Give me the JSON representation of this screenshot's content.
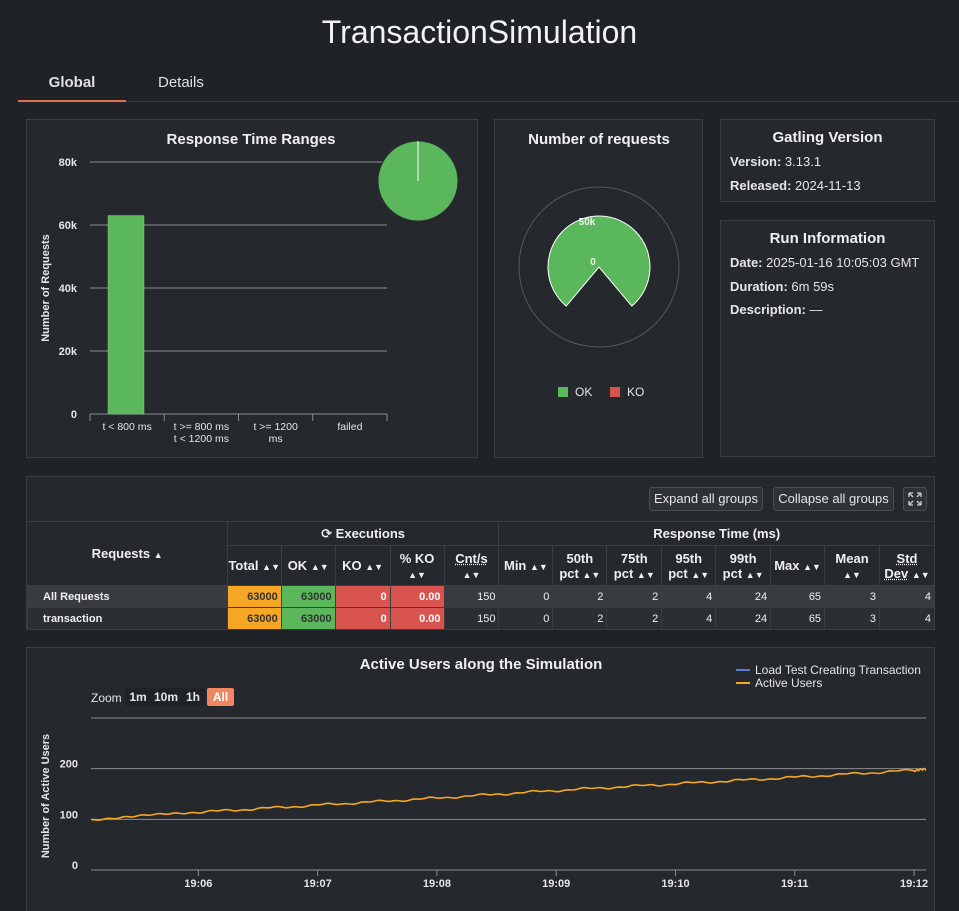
{
  "page": {
    "title": "TransactionSimulation"
  },
  "tabs": [
    {
      "label": "Global"
    },
    {
      "label": "Details"
    }
  ],
  "ranges": {
    "title": "Response Time Ranges",
    "ylabel": "Number of Requests",
    "yticks": [
      "0",
      "20k",
      "40k",
      "60k",
      "80k"
    ],
    "categories": [
      {
        "line1": "t < 800 ms",
        "line2": ""
      },
      {
        "line1": "t >= 800 ms",
        "line2": "t < 1200 ms"
      },
      {
        "line1": "t >= 1200",
        "line2": "ms"
      },
      {
        "line1": "failed",
        "line2": ""
      }
    ]
  },
  "requests_panel": {
    "title": "Number of requests",
    "label_50k": "50k",
    "label_0": "0",
    "legend": [
      {
        "label": "OK",
        "color": "#5bb75b"
      },
      {
        "label": "KO",
        "color": "#d9534f"
      }
    ]
  },
  "gatling": {
    "title": "Gatling Version",
    "version_label": "Version:",
    "version": "3.13.1",
    "released_label": "Released:",
    "released": "2024-11-13"
  },
  "run": {
    "title": "Run Information",
    "date_label": "Date:",
    "date": "2025-01-16 10:05:03 GMT",
    "duration_label": "Duration:",
    "duration": "6m 59s",
    "description_label": "Description:",
    "description": "—"
  },
  "stats": {
    "expand_label": "Expand all groups",
    "collapse_label": "Collapse all groups",
    "requests_header": "Requests",
    "executions_header": "Executions",
    "response_header": "Response Time (ms)",
    "columns": {
      "total": "Total",
      "ok": "OK",
      "ko": "KO",
      "pko": "% KO",
      "cnts": "Cnt/s",
      "min": "Min",
      "p50a": "50th",
      "p50b": "pct",
      "p75a": "75th",
      "p75b": "pct",
      "p95a": "95th",
      "p95b": "pct",
      "p99a": "99th",
      "p99b": "pct",
      "max": "Max",
      "mean": "Mean",
      "stda": "Std",
      "stdb": "Dev"
    },
    "rows": [
      {
        "name": "All Requests",
        "total": "63000",
        "ok": "63000",
        "ko": "0",
        "pko": "0.00",
        "cnts": "150",
        "min": "0",
        "p50": "2",
        "p75": "2",
        "p95": "4",
        "p99": "24",
        "max": "65",
        "mean": "3",
        "std": "4"
      },
      {
        "name": "transaction",
        "total": "63000",
        "ok": "63000",
        "ko": "0",
        "pko": "0.00",
        "cnts": "150",
        "min": "0",
        "p50": "2",
        "p75": "2",
        "p95": "4",
        "p99": "24",
        "max": "65",
        "mean": "3",
        "std": "4"
      }
    ]
  },
  "users": {
    "title": "Active Users along the Simulation",
    "legend1": "Load Test Creating Transaction",
    "legend2": "Active Users",
    "zoom_label": "Zoom",
    "zoom": [
      "1m",
      "10m",
      "1h",
      "All"
    ],
    "ylabel": "Number of Active Users",
    "yticks": [
      "0",
      "100",
      "200"
    ],
    "xticks": [
      "19:06",
      "19:07",
      "19:08",
      "19:09",
      "19:10",
      "19:11",
      "19:12"
    ]
  },
  "colors": {
    "ok": "#5bb75b",
    "ko": "#d9534f",
    "total": "#f5a623",
    "active_users": "#f5a623",
    "load_test": "#5b7bd9",
    "accent": "#e2704f"
  },
  "chart_data": [
    {
      "type": "bar",
      "title": "Response Time Ranges",
      "ylabel": "Number of Requests",
      "categories": [
        "t < 800 ms",
        "t >= 800 ms t < 1200 ms",
        "t >= 1200 ms",
        "failed"
      ],
      "values": [
        63000,
        0,
        0,
        0
      ],
      "ylim": [
        0,
        80000
      ],
      "grid": true
    },
    {
      "type": "pie",
      "title": "Number of requests",
      "categories": [
        "OK",
        "KO"
      ],
      "values": [
        63000,
        0
      ],
      "legend": "bottom"
    },
    {
      "type": "line",
      "title": "Active Users along the Simulation",
      "ylabel": "Number of Active Users",
      "ylim": [
        0,
        300
      ],
      "series": [
        {
          "name": "Active Users",
          "x": [
            "19:05:06",
            "19:06",
            "19:07",
            "19:08",
            "19:09",
            "19:10",
            "19:11",
            "19:12",
            "19:12:06"
          ],
          "values": [
            100,
            114,
            128,
            142,
            157,
            170,
            183,
            197,
            198
          ]
        },
        {
          "name": "Load Test Creating Transaction",
          "x": [],
          "values": []
        }
      ],
      "legend": "top-right"
    }
  ]
}
